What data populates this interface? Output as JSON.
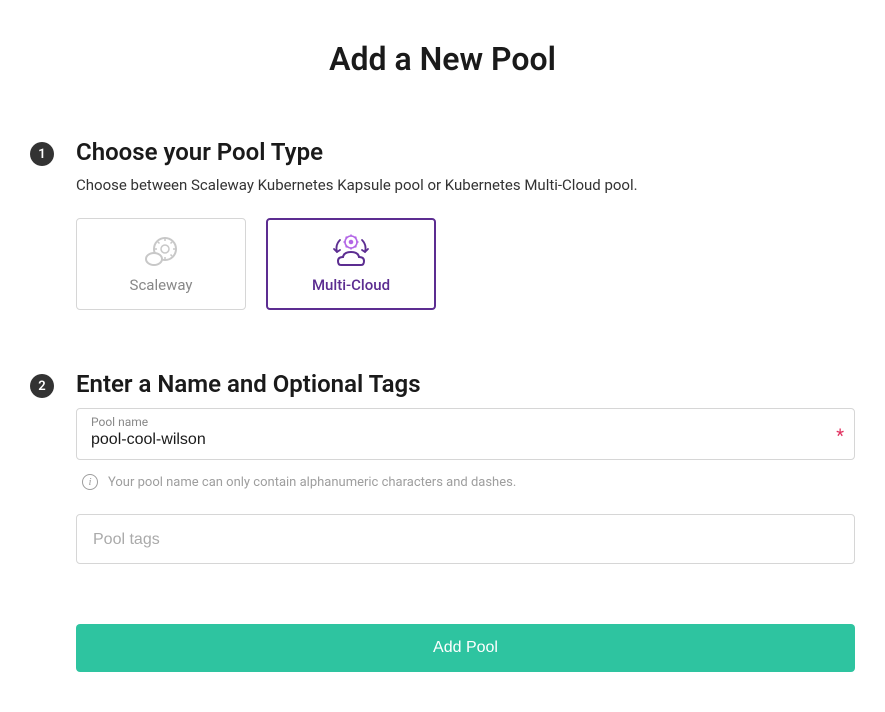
{
  "page": {
    "title": "Add a New Pool"
  },
  "step1": {
    "number": "1",
    "title": "Choose your Pool Type",
    "description": "Choose between Scaleway Kubernetes Kapsule pool or Kubernetes Multi-Cloud pool.",
    "options": {
      "scaleway": {
        "label": "Scaleway",
        "selected": false
      },
      "multicloud": {
        "label": "Multi-Cloud",
        "selected": true
      }
    }
  },
  "step2": {
    "number": "2",
    "title": "Enter a Name and Optional Tags",
    "name_label": "Pool name",
    "name_value": "pool-cool-wilson",
    "help_text": "Your pool name can only contain alphanumeric characters and dashes.",
    "tags_placeholder": "Pool tags",
    "required_indicator": "*"
  },
  "submit": {
    "label": "Add Pool"
  }
}
